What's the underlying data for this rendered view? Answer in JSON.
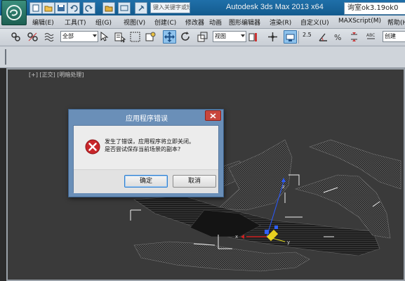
{
  "titlebar": {
    "window_title": "Autodesk 3ds Max  2013 x64",
    "search_value": "询室ok3.19ok0",
    "quick_access_search": "键入关键字或短语"
  },
  "menubar": {
    "items": [
      "编辑(E)",
      "工具(T)",
      "组(G)",
      "视图(V)",
      "创建(C)",
      "修改器",
      "动画",
      "图形编辑器",
      "渲染(R)",
      "自定义(U)",
      "MAXScript(M)",
      "帮助(H)"
    ]
  },
  "toolbar": {
    "selection_filter": "全部",
    "reference_coord": "视图",
    "snap_label": "2.5",
    "selection_set": "创建"
  },
  "viewport": {
    "label": "[+] [正交] [明暗处理]"
  },
  "dialog": {
    "title": "应用程序错误",
    "message_line1": "发生了错误，应用程序将立即关闭。",
    "message_line2": "是否尝试保存当前场景的副本?",
    "ok_label": "确定",
    "cancel_label": "取消"
  },
  "colors": {
    "titlebar": "#1f6fa9",
    "dialog_frame": "#6a8fb8",
    "error_red": "#c8262a",
    "viewport_bg": "#3a3a3a"
  }
}
